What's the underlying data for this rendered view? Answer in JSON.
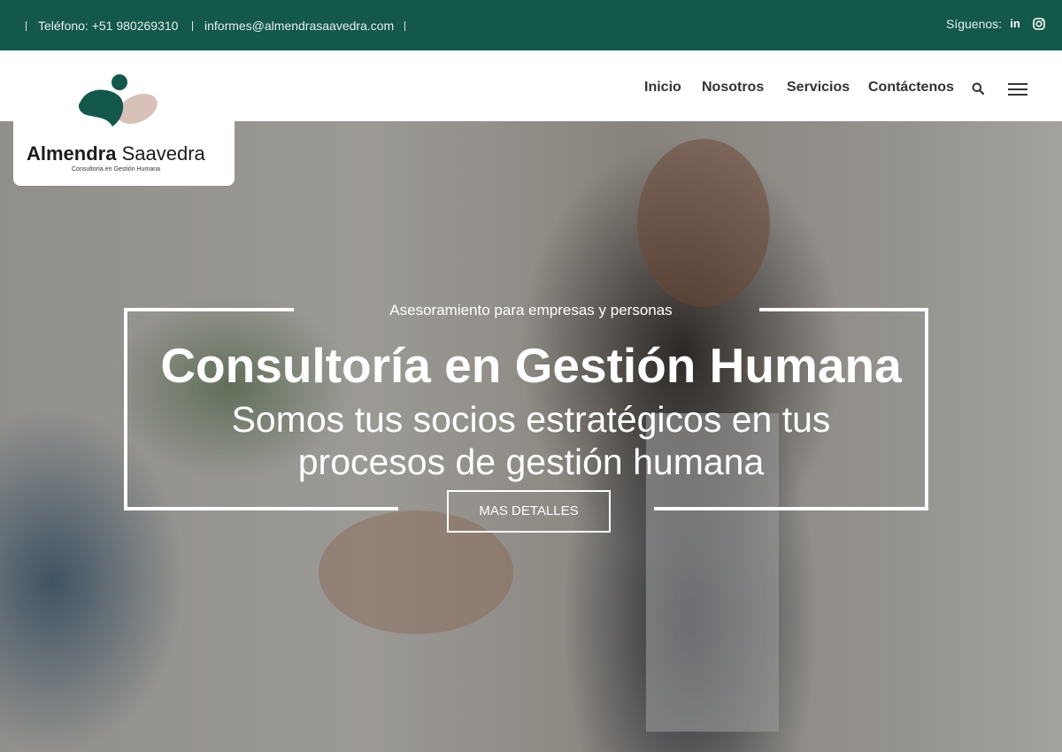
{
  "topbar": {
    "phone": "Teléfono: +51 980269310",
    "email": "informes@almendrasaavedra.com",
    "follow_label": "Síguenos:",
    "social": [
      "linkedin-icon",
      "instagram-icon"
    ],
    "background": "#14574b"
  },
  "logo": {
    "name_bold": "Almendra",
    "name_light": "Saavedra",
    "tagline": "Consultoría en Gestión Humana",
    "colors": {
      "dot": "#14574b",
      "leaf": "#14574b",
      "petal": "#d7c1b8"
    }
  },
  "nav": {
    "items": [
      "Inicio",
      "Nosotros",
      "Servicios",
      "Contáctenos"
    ],
    "search_icon": "search-icon",
    "menu_icon": "hamburger-menu-icon"
  },
  "hero": {
    "kicker": "Asesoramiento para empresas y personas",
    "title": "Consultoría en Gestión Humana",
    "subtitle_line1": "Somos tus socios estratégicos en tus",
    "subtitle_line2": "procesos de gestión humana",
    "cta_label": "MAS DETALLES"
  }
}
